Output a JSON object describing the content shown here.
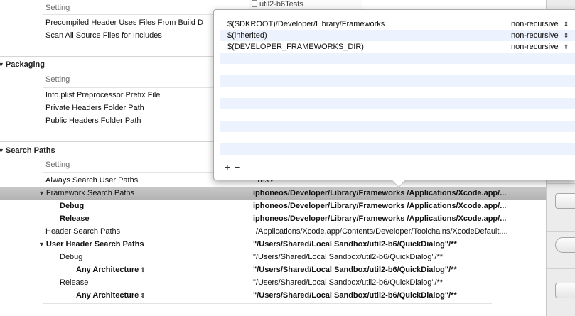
{
  "top_partial_row": {
    "setting_label": "Setting",
    "target": "util2-b6Tests"
  },
  "build_options": [
    {
      "name": "Precompiled Header Uses Files From Build D"
    },
    {
      "name": "Scan All Source Files for Includes"
    }
  ],
  "packaging": {
    "title": "Packaging",
    "header": "Setting",
    "rows": [
      {
        "name": "Info.plist Preprocessor Prefix File"
      },
      {
        "name": "Private Headers Folder Path"
      },
      {
        "name": "Public Headers Folder Path"
      }
    ]
  },
  "search_paths": {
    "title": "Search Paths",
    "header": "Setting",
    "always_search": {
      "name": "Always Search User Paths",
      "value": "Yes"
    },
    "framework": {
      "name": "Framework Search Paths",
      "value": "iphoneos/Developer/Library/Frameworks  /Applications/Xcode.app/...",
      "debug": {
        "name": "Debug",
        "value": "iphoneos/Developer/Library/Frameworks  /Applications/Xcode.app/..."
      },
      "release": {
        "name": "Release",
        "value": "iphoneos/Developer/Library/Frameworks  /Applications/Xcode.app/..."
      }
    },
    "header_search": {
      "name": "Header Search Paths",
      "value": "/Applications/Xcode.app/Contents/Developer/Toolchains/XcodeDefault...."
    },
    "user_header": {
      "name": "User Header Search Paths",
      "value": "\"/Users/Shared/Local Sandbox/util2-b6/QuickDialog\"/**",
      "debug": {
        "name": "Debug",
        "value": "\"/Users/Shared/Local Sandbox/util2-b6/QuickDialog\"/**"
      },
      "debug_arch": {
        "name": "Any Architecture",
        "value": "\"/Users/Shared/Local Sandbox/util2-b6/QuickDialog\"/**"
      },
      "release": {
        "name": "Release",
        "value": "\"/Users/Shared/Local Sandbox/util2-b6/QuickDialog\"/**"
      },
      "release_arch": {
        "name": "Any Architecture",
        "value": "\"/Users/Shared/Local Sandbox/util2-b6/QuickDialog\"/**"
      }
    }
  },
  "popover": {
    "entries": [
      {
        "path": "$(SDKROOT)/Developer/Library/Frameworks",
        "mode": "non-recursive"
      },
      {
        "path": "$(inherited)",
        "mode": "non-recursive"
      },
      {
        "path": "$(DEVELOPER_FRAMEWORKS_DIR)",
        "mode": "non-recursive"
      }
    ],
    "add_label": "+",
    "remove_label": "−"
  },
  "icons": {
    "disclosure_open": "▼",
    "stepper": "⇕",
    "popup_arrow": "▾"
  }
}
